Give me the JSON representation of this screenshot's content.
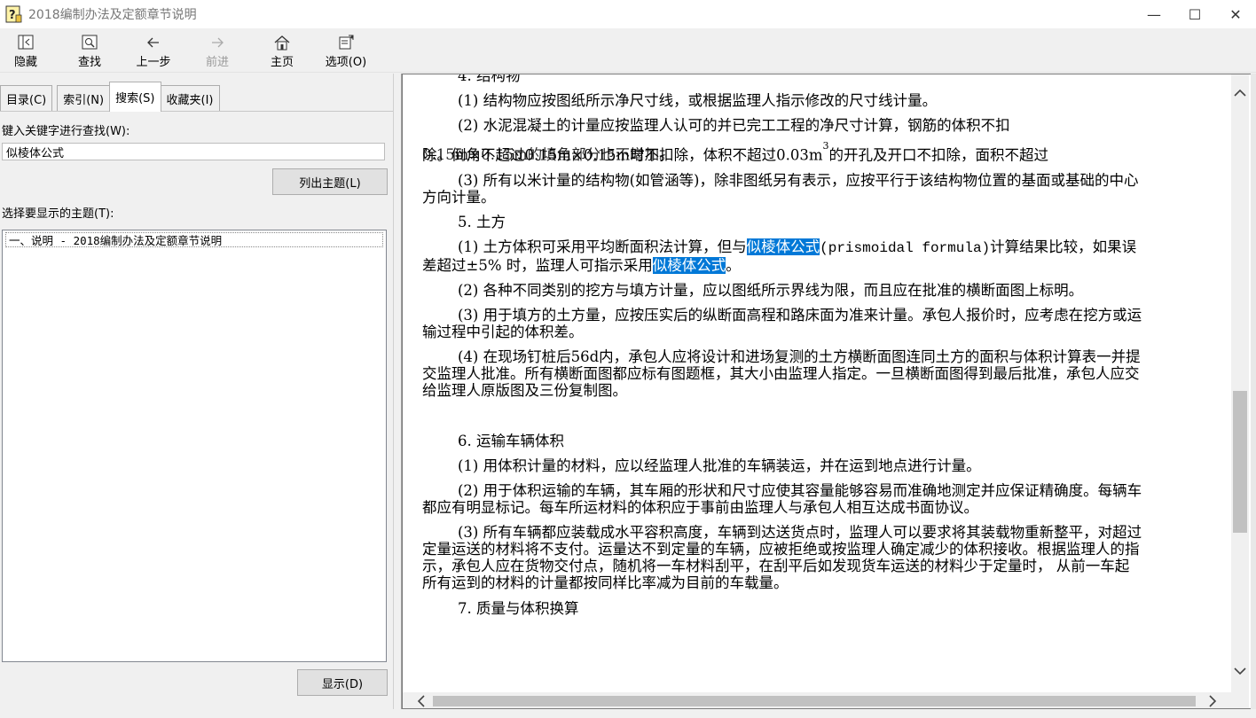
{
  "window": {
    "title": "2018编制办法及定额章节说明",
    "minimize": "—",
    "maximize": "☐",
    "close": "✕"
  },
  "toolbar": {
    "hide": "隐藏",
    "find": "查找",
    "back": "上一步",
    "forward": "前进",
    "home": "主页",
    "options": "选项(O)"
  },
  "tabs": {
    "contents": "目录(C)",
    "index": "索引(N)",
    "search": "搜索(S)",
    "favorites": "收藏夹(I)"
  },
  "search": {
    "keyword_label": "键入关键字进行查找(W):",
    "keyword_value": "似棱体公式",
    "list_topics_button": "列出主题(L)",
    "select_topic_label": "选择要显示的主题(T):",
    "topics": [
      "一、说明 - 2018编制办法及定额章节说明"
    ],
    "display_button": "显示(D)"
  },
  "doc": {
    "s4_heading": "4. 结构物",
    "s4_p1": "(1) 结构物应按图纸所示净尺寸线，或根据监理人指示修改的尺寸线计量。",
    "s4_p2_line1": "(2) 水泥混凝土的计量应按监理人认可的并已完工工程的净尺寸计算，钢筋的体积不扣",
    "s4_p2_line2": "除。倒角不超过0.15m×0.15m时不扣除，体积不超过0.03m",
    "s4_p2_sup": "3",
    "s4_p2_line3": "的开孔及开口不扣除，面积不超过",
    "s4_p2_line4": "0.15m×0.15m的填角部分也不增加。",
    "s4_p3": "(3) 所有以米计量的结构物(如管涵等)，除非图纸另有表示，应按平行于该结构物位置的基面或基础的中心方向计量。",
    "s5_heading": "5. 土方",
    "s5_p1_a": "(1) 土方体积可采用平均断面积法计算，但与",
    "s5_p1_hl1": "似棱体公式",
    "s5_p1_b": "(prismoidal formula)",
    "s5_p1_c": "计算结果比较，如果误差超过±5% 时，监理人可指示采用",
    "s5_p1_hl2": "似棱体公式",
    "s5_p1_d": "。",
    "s5_p2": "(2) 各种不同类别的挖方与填方计量，应以图纸所示界线为限，而且应在批准的横断面图上标明。",
    "s5_p3": "(3) 用于填方的土方量，应按压实后的纵断面高程和路床面为准来计量。承包人报价时，应考虑在挖方或运输过程中引起的体积差。",
    "s5_p4": "(4) 在现场钉桩后56d内，承包人应将设计和进场复测的土方横断面图连同土方的面积与体积计算表一并提交监理人批准。所有横断面图都应标有图题框，其大小由监理人指定。一旦横断面图得到最后批准，承包人应交给监理人原版图及三份复制图。",
    "s6_heading": "6. 运输车辆体积",
    "s6_p1": "(1) 用体积计量的材料，应以经监理人批准的车辆装运，并在运到地点进行计量。",
    "s6_p2": "(2) 用于体积运输的车辆，其车厢的形状和尺寸应使其容量能够容易而准确地测定并应保证精确度。每辆车都应有明显标记。每车所运材料的体积应于事前由监理人与承包人相互达成书面协议。",
    "s6_p3": "(3) 所有车辆都应装载成水平容积高度，车辆到达送货点时，监理人可以要求将其装载物重新整平，对超过定量运送的材料将不支付。运量达不到定量的车辆，应被拒绝或按监理人确定减少的体积接收。根据监理人的指示，承包人应在货物交付点，随机将一车材料刮平，在刮平后如发现货车运送的材料少于定量时， 从前一车起所有运到的材料的计量都按同样比率减为目前的车载量。",
    "s7_heading": "7. 质量与体积换算"
  },
  "colors": {
    "highlight": "#0078d7",
    "window_bg": "#f0f0f0"
  },
  "icons": [
    "help-file-icon",
    "hide-icon",
    "find-icon",
    "back-arrow-icon",
    "forward-arrow-icon",
    "home-icon",
    "options-icon",
    "scroll-up-icon",
    "scroll-down-icon",
    "scroll-left-icon",
    "scroll-right-icon"
  ]
}
